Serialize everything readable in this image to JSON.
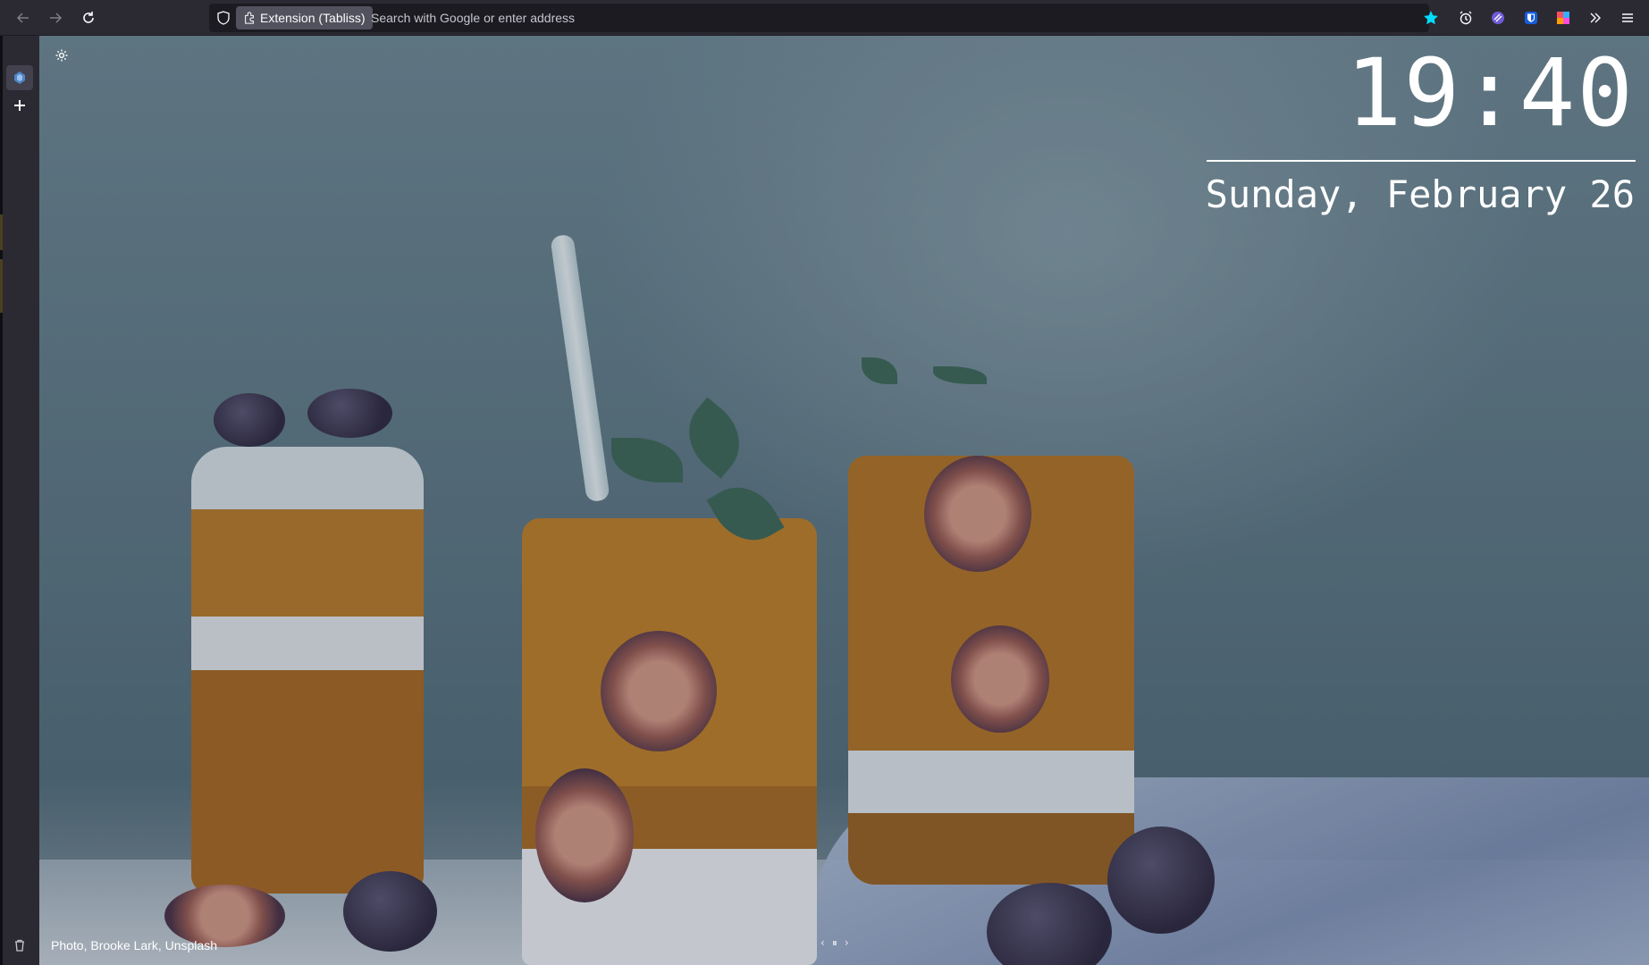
{
  "browser": {
    "back_icon": "arrow-left-icon",
    "forward_icon": "arrow-right-icon",
    "reload_icon": "reload-icon",
    "shield_icon": "shield-icon",
    "extension_chip_label": "Extension (Tabliss)",
    "address_placeholder": "Search with Google or enter address",
    "toolbar_icons": [
      "star-icon",
      "alarm-clock-icon",
      "extension-purple-icon",
      "bitwarden-icon",
      "multi-account-containers-icon",
      "overflow-chevrons-icon",
      "hamburger-menu-icon"
    ],
    "accent_color": "#00ddff"
  },
  "sidebar": {
    "items": [
      {
        "icon": "tabliss-icon",
        "active": true
      },
      {
        "icon": "plus-icon",
        "active": false
      }
    ],
    "bottom_icon": "trash-icon"
  },
  "newtab": {
    "clock": "19:40",
    "date": "Sunday, February 26",
    "photo_credit": "Photo, Brooke Lark, Unsplash",
    "settings_icon": "gear-icon",
    "nav": {
      "prev": "‹",
      "pause": "⏸",
      "next": "›"
    }
  }
}
